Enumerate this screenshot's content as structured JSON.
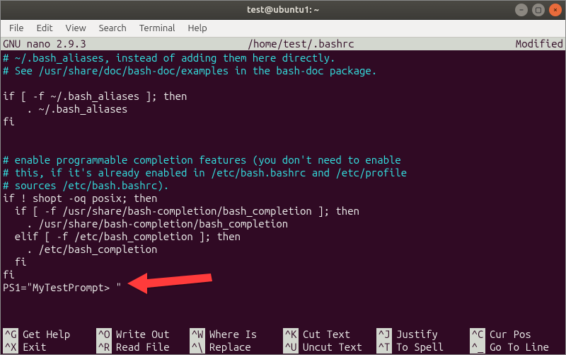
{
  "window": {
    "title": "test@ubuntu1: ~"
  },
  "menubar": [
    "File",
    "Edit",
    "View",
    "Search",
    "Terminal",
    "Help"
  ],
  "nano": {
    "app": "GNU nano 2.9.3",
    "filepath": "/home/test/.bashrc",
    "status": "Modified"
  },
  "lines": [
    {
      "cls": "comment",
      "text": "# ~/.bash_aliases, instead of adding them here directly."
    },
    {
      "cls": "comment",
      "text": "# See /usr/share/doc/bash-doc/examples in the bash-doc package."
    },
    {
      "cls": "code",
      "text": ""
    },
    {
      "cls": "code",
      "text": "if [ -f ~/.bash_aliases ]; then"
    },
    {
      "cls": "code",
      "text": "    . ~/.bash_aliases"
    },
    {
      "cls": "code",
      "text": "fi"
    },
    {
      "cls": "code",
      "text": ""
    },
    {
      "cls": "code",
      "text": ""
    },
    {
      "cls": "comment",
      "text": "# enable programmable completion features (you don't need to enable"
    },
    {
      "cls": "comment",
      "text": "# this, if it's already enabled in /etc/bash.bashrc and /etc/profile"
    },
    {
      "cls": "comment",
      "text": "# sources /etc/bash.bashrc)."
    },
    {
      "cls": "code",
      "text": "if ! shopt -oq posix; then"
    },
    {
      "cls": "code",
      "text": "  if [ -f /usr/share/bash-completion/bash_completion ]; then"
    },
    {
      "cls": "code",
      "text": "    . /usr/share/bash-completion/bash_completion"
    },
    {
      "cls": "code",
      "text": "  elif [ -f /etc/bash_completion ]; then"
    },
    {
      "cls": "code",
      "text": "    . /etc/bash_completion"
    },
    {
      "cls": "code",
      "text": "  fi"
    },
    {
      "cls": "code",
      "text": "fi"
    },
    {
      "cls": "code",
      "text": "PS1=\"MyTestPrompt> \""
    }
  ],
  "shortcuts_row1": [
    {
      "key": "^G",
      "label": "Get Help"
    },
    {
      "key": "^O",
      "label": "Write Out"
    },
    {
      "key": "^W",
      "label": "Where Is"
    },
    {
      "key": "^K",
      "label": "Cut Text"
    },
    {
      "key": "^J",
      "label": "Justify"
    },
    {
      "key": "^C",
      "label": "Cur Pos"
    }
  ],
  "shortcuts_row2": [
    {
      "key": "^X",
      "label": "Exit"
    },
    {
      "key": "^R",
      "label": "Read File"
    },
    {
      "key": "^\\",
      "label": "Replace"
    },
    {
      "key": "^U",
      "label": "Uncut Text"
    },
    {
      "key": "^T",
      "label": "To Spell"
    },
    {
      "key": "^_",
      "label": "Go To Line"
    }
  ]
}
